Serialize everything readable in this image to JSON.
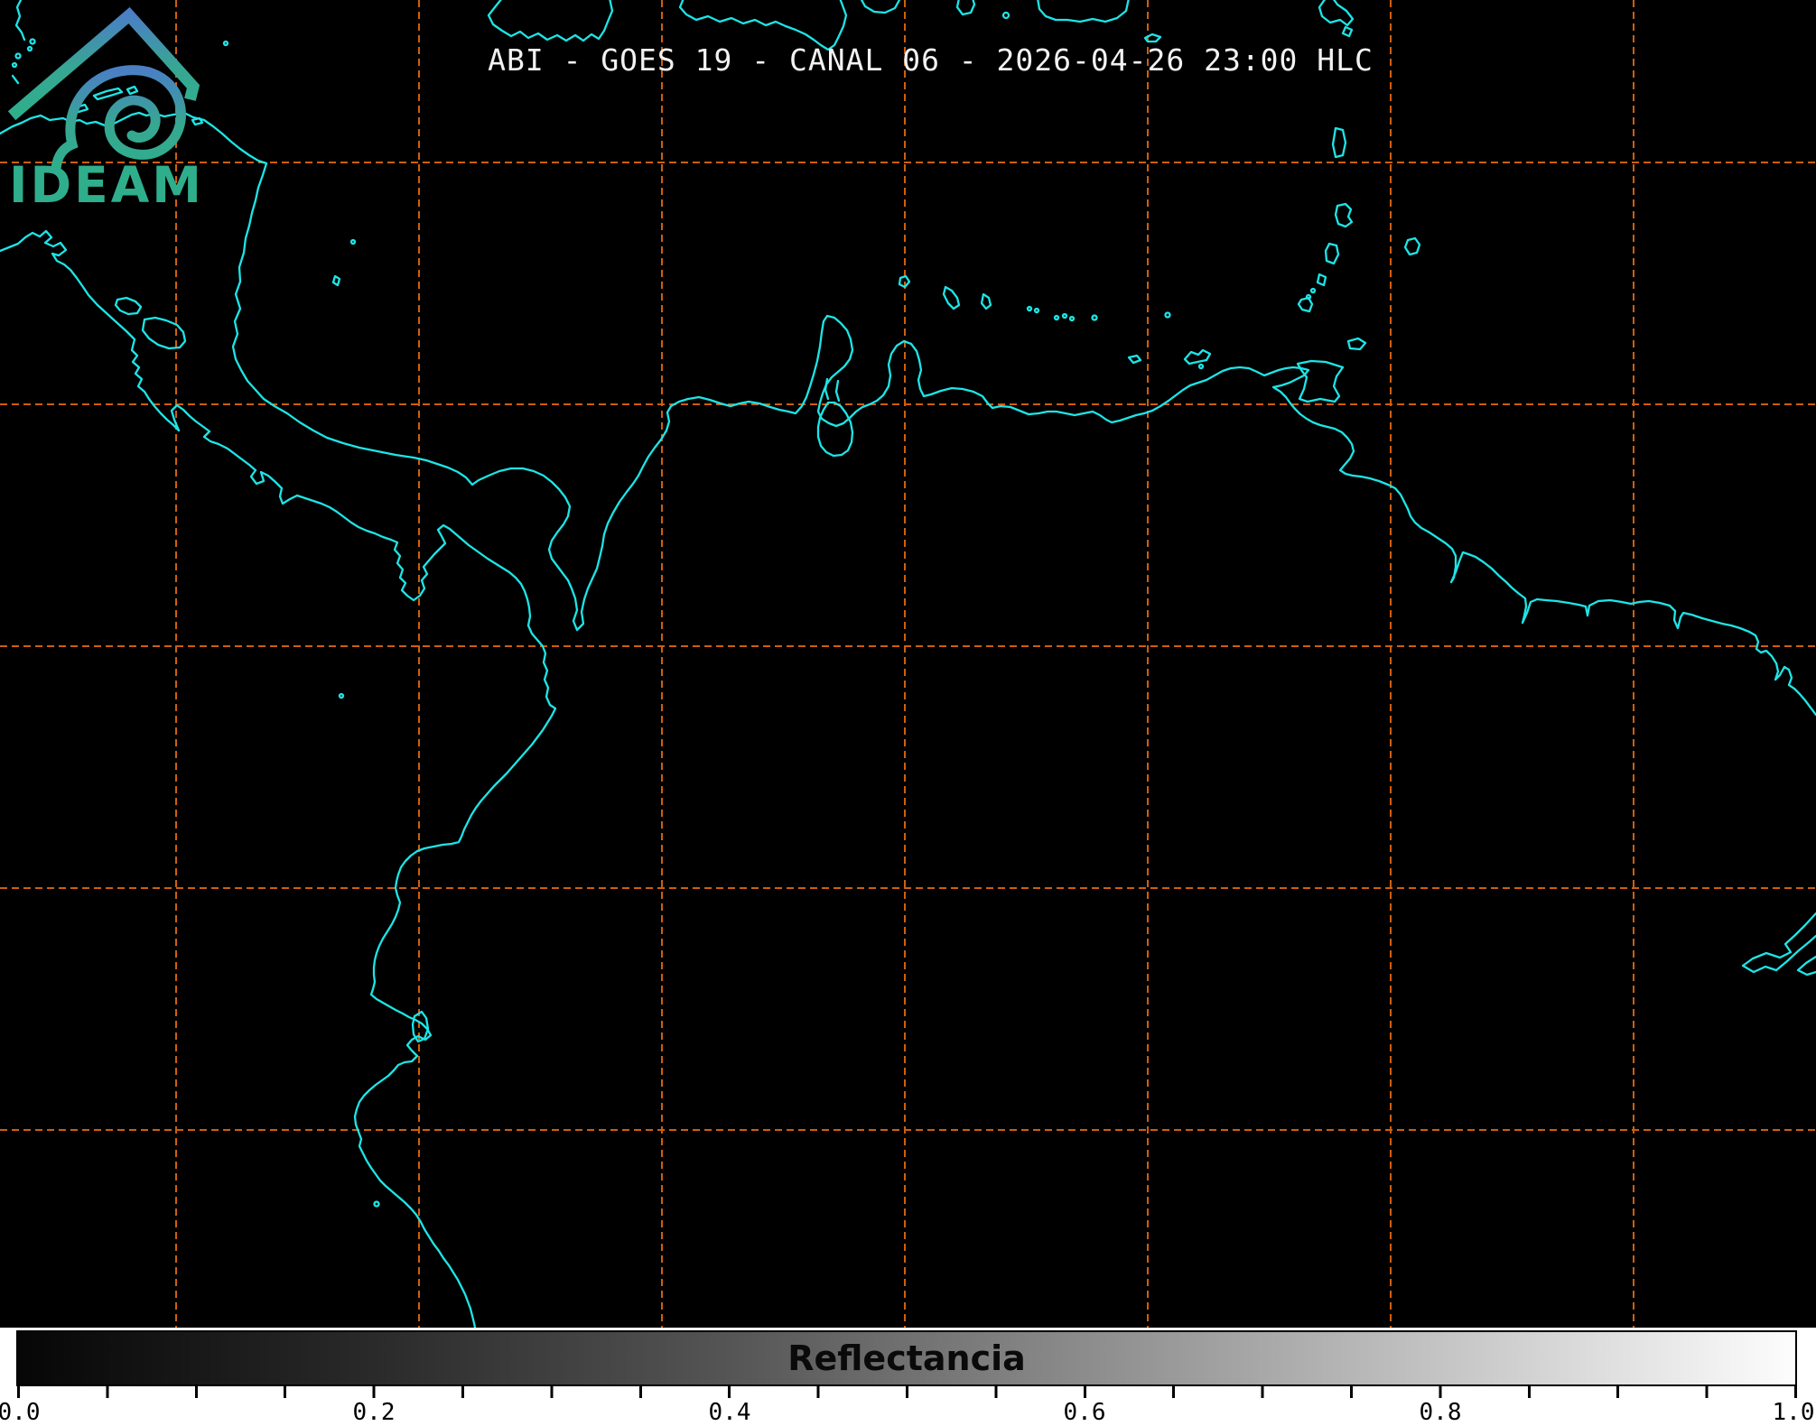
{
  "header": {
    "title": "ABI - GOES 19 - CANAL 06 - 2026-04-26 23:00 HLC",
    "satellite": "GOES 19",
    "instrument": "ABI",
    "channel": "CANAL 06",
    "datetime": "2026-04-26 23:00",
    "timezone_label": "HLC"
  },
  "colorbar": {
    "label": "Reflectancia",
    "min": 0.0,
    "max": 1.0,
    "tick_labels": [
      "0.0",
      "0.2",
      "0.4",
      "0.6",
      "0.8",
      "1.0"
    ],
    "gradient": [
      "#000000",
      "#ffffff"
    ]
  },
  "logo": {
    "text": "IDEAM",
    "icon": "mountain-hurricane-spiral",
    "text_color": "#2fae8c",
    "gradient_top": "#4a7fc4",
    "gradient_bottom": "#2fae8c"
  },
  "map": {
    "background_color": "#000000",
    "coastline_color": "#1de5e7",
    "gridline_color": "#ce5f0d",
    "gridline_style": "dashed",
    "region": "Central America and northern South America"
  }
}
